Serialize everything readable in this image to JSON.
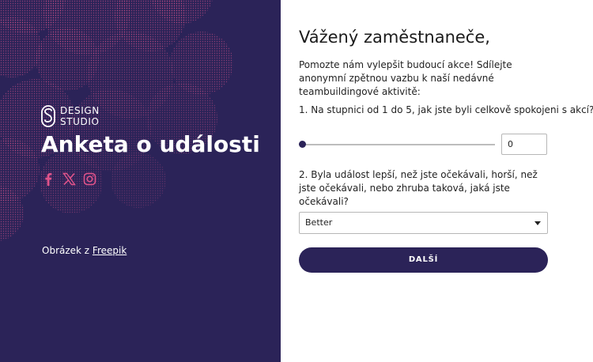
{
  "hero": {
    "logo_line1": "DESIGN",
    "logo_line2": "STUDIO",
    "title": "Anketa o události",
    "social_icons": [
      "facebook-icon",
      "x-twitter-icon",
      "instagram-icon"
    ],
    "credit_prefix": "Obrázek z ",
    "credit_link": "Freepik"
  },
  "form": {
    "greeting": "Vážený zaměstnaneče,",
    "intro": "Pomozte nám vylepšit budoucí akce! Sdílejte anonymní zpětnou vazbu k naší nedávné teambuildingové aktivitě:",
    "question1": "1. Na stupnici od 1 do 5, jak jste byli celkově spokojeni s akcí?",
    "rating_value": "0",
    "question2": "2. Byla událost lepší, než jste očekávali, horší, než jste očekávali, nebo zhruba taková, jaká jste očekávali?",
    "select_value": "Better",
    "next_button": "DALŠÍ"
  },
  "colors": {
    "panel_background": "#2b2358",
    "pattern_accent": "#e0538a",
    "button_background": "#2b2358",
    "button_text": "#ffffff"
  }
}
